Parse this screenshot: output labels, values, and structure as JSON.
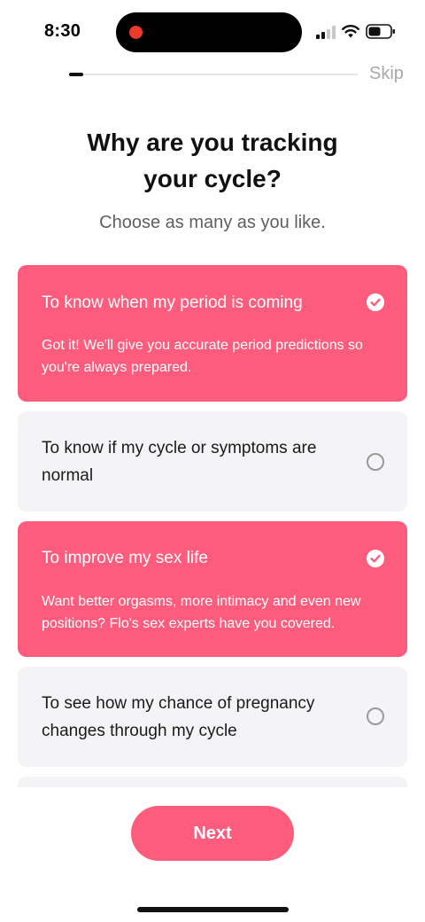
{
  "status_bar": {
    "time": "8:30",
    "icons": [
      "recording-indicator-icon",
      "cellular-signal-icon",
      "wifi-icon",
      "battery-icon"
    ]
  },
  "progress": {
    "fraction": 0.05,
    "skip_label": "Skip"
  },
  "title_lines": [
    "Why are you tracking",
    "your cycle?"
  ],
  "subtitle": "Choose as many as you like.",
  "options": [
    {
      "label": "To know when my period is coming",
      "selected": true,
      "description": "Got it! We'll give you accurate period predictions so you're always prepared."
    },
    {
      "label": "To know if my cycle or symptoms are normal",
      "selected": false
    },
    {
      "label": "To improve my sex life",
      "selected": true,
      "description": "Want better orgasms, more intimacy and even new positions? Flo's sex experts have you covered."
    },
    {
      "label": "To see how my chance of pregnancy changes through my cycle",
      "selected": false
    }
  ],
  "next_label": "Next",
  "colors": {
    "accent": "#fe5c7d",
    "card_unselected": "#f4f4f6",
    "recording_dot": "#ec3a2b"
  }
}
